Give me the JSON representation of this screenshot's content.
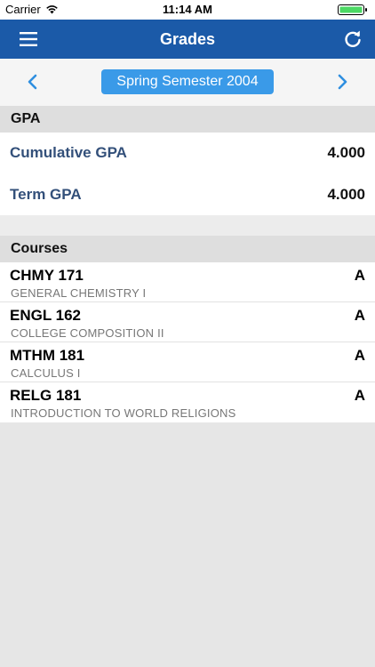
{
  "status_bar": {
    "carrier": "Carrier",
    "time": "11:14 AM",
    "wifi_icon": "wifi-icon",
    "battery_icon": "battery-icon",
    "battery_level": 1.0
  },
  "nav": {
    "title": "Grades",
    "menu_icon": "hamburger-menu-icon",
    "refresh_icon": "refresh-icon"
  },
  "semester": {
    "label": "Spring Semester 2004",
    "prev_icon": "chevron-left-icon",
    "next_icon": "chevron-right-icon"
  },
  "gpa_section": {
    "header": "GPA",
    "rows": [
      {
        "label": "Cumulative GPA",
        "value": "4.000"
      },
      {
        "label": "Term GPA",
        "value": "4.000"
      }
    ]
  },
  "courses_section": {
    "header": "Courses",
    "items": [
      {
        "code": "CHMY 171",
        "title": "GENERAL CHEMISTRY I",
        "grade": "A"
      },
      {
        "code": "ENGL 162",
        "title": "COLLEGE COMPOSITION II",
        "grade": "A"
      },
      {
        "code": "MTHM 181",
        "title": "CALCULUS I",
        "grade": "A"
      },
      {
        "code": "RELG 181",
        "title": "INTRODUCTION TO WORLD RELIGIONS",
        "grade": "A"
      }
    ]
  },
  "colors": {
    "nav_background": "#1b5aa8",
    "accent": "#3a9ae8",
    "gpa_label": "#33507a",
    "battery_fill": "#4cd964"
  }
}
